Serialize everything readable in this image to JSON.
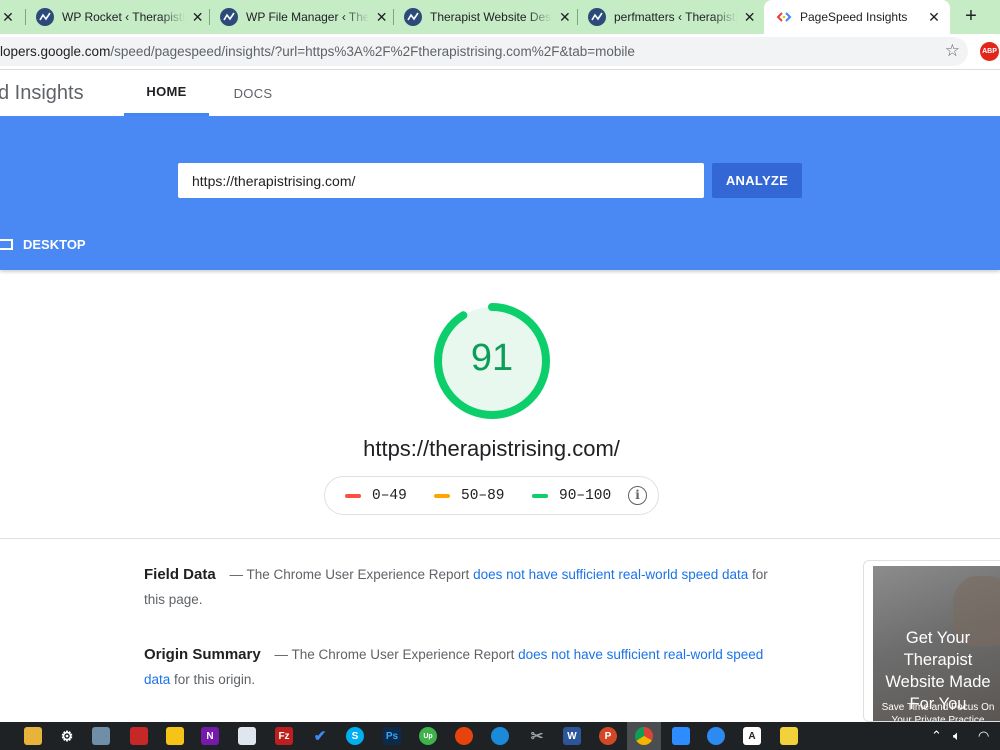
{
  "browser": {
    "tabs": [
      {
        "title": "",
        "close": "✕"
      },
      {
        "title": "WP Rocket ‹ TherapistRising",
        "close": "✕"
      },
      {
        "title": "WP File Manager ‹ Therapist",
        "close": "✕"
      },
      {
        "title": "Therapist Website Design",
        "close": "✕"
      },
      {
        "title": "perfmatters ‹ TherapistRising",
        "close": "✕"
      },
      {
        "title": "PageSpeed Insights",
        "close": "✕"
      }
    ],
    "new_tab": "+",
    "address": {
      "host": "lopers.google.com",
      "path": "/speed/pagespeed/insights/?url=https%3A%2F%2Ftherapistrising.com%2F&tab=mobile"
    },
    "abp_label": "ABP"
  },
  "header": {
    "brand": "d Insights",
    "nav": {
      "home": "HOME",
      "docs": "DOCS"
    }
  },
  "search": {
    "value": "https://therapistrising.com/",
    "analyze_label": "ANALYZE",
    "desktop_label": "DESKTOP"
  },
  "score": {
    "value": "91",
    "fraction": 0.91,
    "color": "#0cce6b",
    "url": "https://therapistrising.com/"
  },
  "legend": [
    {
      "range": "0–49",
      "color": "#ff4e42"
    },
    {
      "range": "50–89",
      "color": "#ffa400"
    },
    {
      "range": "90–100",
      "color": "#0cce6b"
    }
  ],
  "field_data": {
    "heading": "Field Data",
    "text_before": "— The Chrome User Experience Report",
    "link": "does not have sufficient real-world speed data",
    "text_after": "for this page."
  },
  "origin_summary": {
    "heading": "Origin Summary",
    "text_before": "— The Chrome User Experience Report",
    "link": "does not have sufficient real-world speed data",
    "text_after": "for this origin."
  },
  "ad": {
    "headline": "Get Your Therapist Website Made For You",
    "sub": "Save Time and Focus On Your Private Practice"
  }
}
